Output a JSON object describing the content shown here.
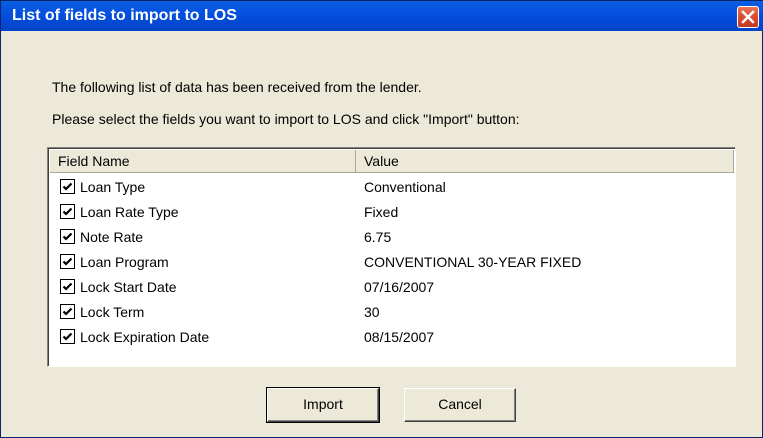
{
  "window": {
    "title": "List of fields to import to LOS"
  },
  "intro": {
    "line1": "The following list of data has been received from the lender.",
    "line2": "Please select the fields you want to import to LOS and  click \"Import\" button:"
  },
  "list": {
    "columns": [
      "Field Name",
      "Value"
    ],
    "rows": [
      {
        "checked": true,
        "field": "Loan Type",
        "value": "Conventional"
      },
      {
        "checked": true,
        "field": "Loan Rate Type",
        "value": "Fixed"
      },
      {
        "checked": true,
        "field": "Note Rate",
        "value": "6.75"
      },
      {
        "checked": true,
        "field": "Loan Program",
        "value": "CONVENTIONAL 30-YEAR FIXED"
      },
      {
        "checked": true,
        "field": "Lock Start Date",
        "value": "07/16/2007"
      },
      {
        "checked": true,
        "field": "Lock Term",
        "value": "30"
      },
      {
        "checked": true,
        "field": "Lock Expiration Date",
        "value": "08/15/2007"
      }
    ]
  },
  "buttons": {
    "import_label": "Import",
    "cancel_label": "Cancel"
  },
  "icons": {
    "close": "close-icon",
    "checkbox": "checkmark-icon"
  },
  "colors": {
    "titlebar": "#0550e0",
    "close_button": "#d8452a",
    "dialog_background": "#ece9d8"
  }
}
